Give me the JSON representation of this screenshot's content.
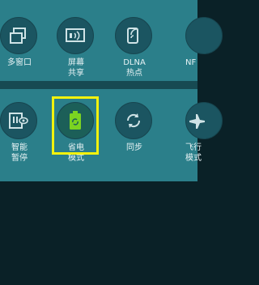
{
  "quick_settings": {
    "row1": [
      {
        "label": "多窗口",
        "icon": "multi-window-icon"
      },
      {
        "label": "屏幕\n共享",
        "icon": "screen-mirroring-icon"
      },
      {
        "label": "DLNA\n热点",
        "icon": "dlna-hotspot-icon"
      },
      {
        "label": "NF",
        "icon": "nfc-icon"
      }
    ],
    "row2": [
      {
        "label": "智能\n暂停",
        "icon": "smart-pause-icon"
      },
      {
        "label": "省电\n模式",
        "icon": "power-saving-icon",
        "active": true
      },
      {
        "label": "同步",
        "icon": "sync-icon"
      },
      {
        "label": "飞行\n模式",
        "icon": "airplane-icon"
      }
    ]
  },
  "colors": {
    "panel": "#2b7f8a",
    "tile": "#1b5561",
    "highlight": "#f2f20e",
    "active_icon": "#7bd321"
  }
}
